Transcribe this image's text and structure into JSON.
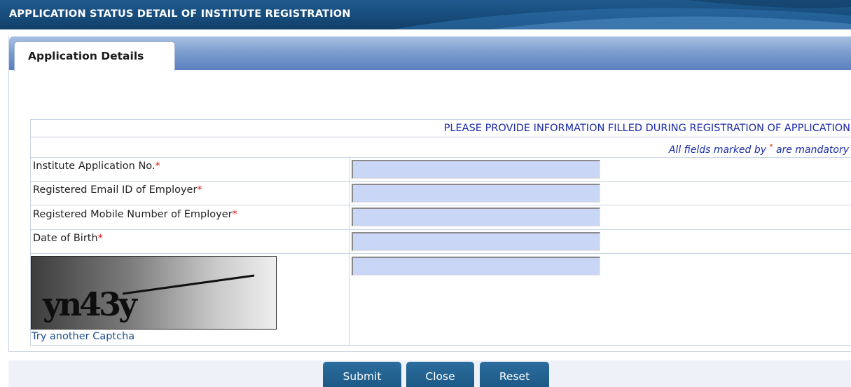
{
  "header": {
    "title": "APPLICATION STATUS DETAIL OF INSTITUTE REGISTRATION"
  },
  "tabs": [
    {
      "label": "Application Details"
    }
  ],
  "form": {
    "instruction": "PLEASE PROVIDE INFORMATION FILLED DURING REGISTRATION OF APPLICATION",
    "mandatory_note_prefix": "All fields marked by ",
    "mandatory_star": "*",
    "mandatory_note_suffix": " are mandatory",
    "required_marker": "*",
    "fields": [
      {
        "label": "Institute Application No.",
        "value": ""
      },
      {
        "label": "Registered Email ID of Employer",
        "value": ""
      },
      {
        "label": "Registered Mobile Number of Employer",
        "value": ""
      },
      {
        "label": "Date of Birth",
        "value": ""
      }
    ],
    "captcha": {
      "text": "yn43y",
      "input_value": "",
      "refresh_label": "Try another Captcha"
    }
  },
  "buttons": {
    "submit": "Submit",
    "close": "Close",
    "reset": "Reset"
  },
  "colors": {
    "banner": "#174c7c",
    "tab_strip": "#7f9fd0",
    "info_text": "#1a2aa8",
    "required_marker": "#e01515",
    "input_bg": "#c9d6f5",
    "button": "#1d5987"
  }
}
